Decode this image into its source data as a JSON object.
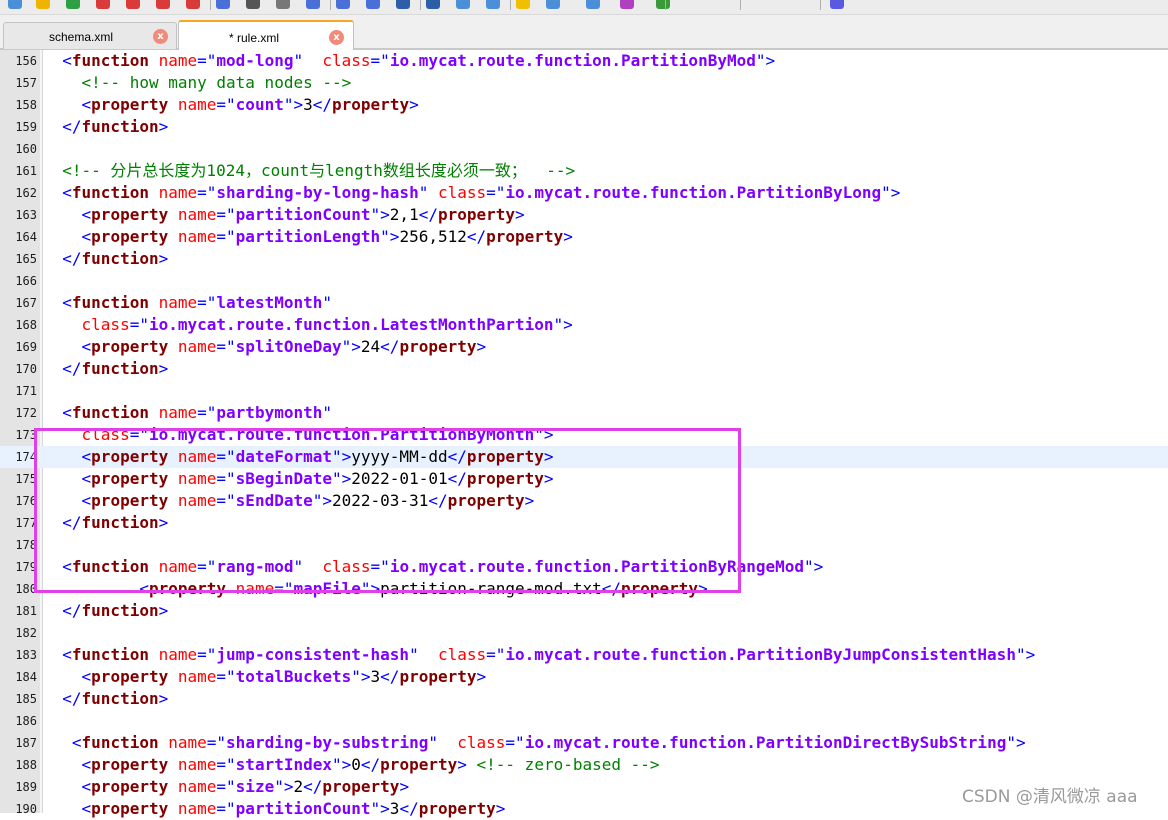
{
  "tabs": [
    {
      "label": "schema.xml",
      "active": false,
      "close": "x"
    },
    {
      "label": "* rule.xml",
      "active": true,
      "close": "x"
    }
  ],
  "editor_lines": [
    {
      "num": "156",
      "tokens": [
        [
          "ind",
          "  "
        ],
        [
          "p",
          "<"
        ],
        [
          "tag",
          "function"
        ],
        [
          "txt",
          " "
        ],
        [
          "attr",
          "name"
        ],
        [
          "p",
          "=\""
        ],
        [
          "val",
          "mod-long"
        ],
        [
          "p",
          "\""
        ],
        [
          "txt",
          "  "
        ],
        [
          "attr",
          "class"
        ],
        [
          "p",
          "=\""
        ],
        [
          "val",
          "io.mycat.route.function.PartitionByMod"
        ],
        [
          "p",
          "\">"
        ]
      ]
    },
    {
      "num": "157",
      "tokens": [
        [
          "ind",
          "    "
        ],
        [
          "com",
          "<!-- how many data nodes -->"
        ]
      ]
    },
    {
      "num": "158",
      "tokens": [
        [
          "ind",
          "    "
        ],
        [
          "p",
          "<"
        ],
        [
          "tag",
          "property"
        ],
        [
          "txt",
          " "
        ],
        [
          "attr",
          "name"
        ],
        [
          "p",
          "=\""
        ],
        [
          "val",
          "count"
        ],
        [
          "p",
          "\">"
        ],
        [
          "txt",
          "3"
        ],
        [
          "p",
          "</"
        ],
        [
          "tag",
          "property"
        ],
        [
          "p",
          ">"
        ]
      ]
    },
    {
      "num": "159",
      "tokens": [
        [
          "ind",
          "  "
        ],
        [
          "p",
          "</"
        ],
        [
          "tag",
          "function"
        ],
        [
          "p",
          ">"
        ]
      ]
    },
    {
      "num": "160",
      "tokens": []
    },
    {
      "num": "161",
      "tokens": [
        [
          "ind",
          "  "
        ],
        [
          "com",
          "<!-- 分片总长度为1024，count与length数组长度必须一致；  -->"
        ]
      ]
    },
    {
      "num": "162",
      "tokens": [
        [
          "ind",
          "  "
        ],
        [
          "p",
          "<"
        ],
        [
          "tag",
          "function"
        ],
        [
          "txt",
          " "
        ],
        [
          "attr",
          "name"
        ],
        [
          "p",
          "=\""
        ],
        [
          "val",
          "sharding-by-long-hash"
        ],
        [
          "p",
          "\""
        ],
        [
          "txt",
          " "
        ],
        [
          "attr",
          "class"
        ],
        [
          "p",
          "=\""
        ],
        [
          "val",
          "io.mycat.route.function.PartitionByLong"
        ],
        [
          "p",
          "\">"
        ]
      ]
    },
    {
      "num": "163",
      "tokens": [
        [
          "ind",
          "    "
        ],
        [
          "p",
          "<"
        ],
        [
          "tag",
          "property"
        ],
        [
          "txt",
          " "
        ],
        [
          "attr",
          "name"
        ],
        [
          "p",
          "=\""
        ],
        [
          "val",
          "partitionCount"
        ],
        [
          "p",
          "\">"
        ],
        [
          "txt",
          "2,1"
        ],
        [
          "p",
          "</"
        ],
        [
          "tag",
          "property"
        ],
        [
          "p",
          ">"
        ]
      ]
    },
    {
      "num": "164",
      "tokens": [
        [
          "ind",
          "    "
        ],
        [
          "p",
          "<"
        ],
        [
          "tag",
          "property"
        ],
        [
          "txt",
          " "
        ],
        [
          "attr",
          "name"
        ],
        [
          "p",
          "=\""
        ],
        [
          "val",
          "partitionLength"
        ],
        [
          "p",
          "\">"
        ],
        [
          "txt",
          "256,512"
        ],
        [
          "p",
          "</"
        ],
        [
          "tag",
          "property"
        ],
        [
          "p",
          ">"
        ]
      ]
    },
    {
      "num": "165",
      "tokens": [
        [
          "ind",
          "  "
        ],
        [
          "p",
          "</"
        ],
        [
          "tag",
          "function"
        ],
        [
          "p",
          ">"
        ]
      ]
    },
    {
      "num": "166",
      "tokens": []
    },
    {
      "num": "167",
      "tokens": [
        [
          "ind",
          "  "
        ],
        [
          "p",
          "<"
        ],
        [
          "tag",
          "function"
        ],
        [
          "txt",
          " "
        ],
        [
          "attr",
          "name"
        ],
        [
          "p",
          "=\""
        ],
        [
          "val",
          "latestMonth"
        ],
        [
          "p",
          "\""
        ]
      ]
    },
    {
      "num": "168",
      "tokens": [
        [
          "ind",
          "    "
        ],
        [
          "attr",
          "class"
        ],
        [
          "p",
          "=\""
        ],
        [
          "val",
          "io.mycat.route.function.LatestMonthPartion"
        ],
        [
          "p",
          "\">"
        ]
      ]
    },
    {
      "num": "169",
      "tokens": [
        [
          "ind",
          "    "
        ],
        [
          "p",
          "<"
        ],
        [
          "tag",
          "property"
        ],
        [
          "txt",
          " "
        ],
        [
          "attr",
          "name"
        ],
        [
          "p",
          "=\""
        ],
        [
          "val",
          "splitOneDay"
        ],
        [
          "p",
          "\">"
        ],
        [
          "txt",
          "24"
        ],
        [
          "p",
          "</"
        ],
        [
          "tag",
          "property"
        ],
        [
          "p",
          ">"
        ]
      ]
    },
    {
      "num": "170",
      "tokens": [
        [
          "ind",
          "  "
        ],
        [
          "p",
          "</"
        ],
        [
          "tag",
          "function"
        ],
        [
          "p",
          ">"
        ]
      ]
    },
    {
      "num": "171",
      "tokens": []
    },
    {
      "num": "172",
      "tokens": [
        [
          "ind",
          "  "
        ],
        [
          "p",
          "<"
        ],
        [
          "tag",
          "function"
        ],
        [
          "txt",
          " "
        ],
        [
          "attr",
          "name"
        ],
        [
          "p",
          "=\""
        ],
        [
          "val",
          "partbymonth"
        ],
        [
          "p",
          "\""
        ]
      ]
    },
    {
      "num": "173",
      "tokens": [
        [
          "ind",
          "    "
        ],
        [
          "attr",
          "class"
        ],
        [
          "p",
          "=\""
        ],
        [
          "val",
          "io.mycat.route.function.PartitionByMonth"
        ],
        [
          "p",
          "\">"
        ]
      ]
    },
    {
      "num": "174",
      "current": true,
      "tokens": [
        [
          "ind",
          "    "
        ],
        [
          "p",
          "<"
        ],
        [
          "tag",
          "property"
        ],
        [
          "txt",
          " "
        ],
        [
          "attr",
          "name"
        ],
        [
          "p",
          "=\""
        ],
        [
          "val",
          "dateFormat"
        ],
        [
          "p",
          "\">"
        ],
        [
          "txt",
          "yyyy-MM-dd"
        ],
        [
          "p",
          "</"
        ],
        [
          "tag",
          "property"
        ],
        [
          "p",
          ">"
        ]
      ]
    },
    {
      "num": "175",
      "tokens": [
        [
          "ind",
          "    "
        ],
        [
          "p",
          "<"
        ],
        [
          "tag",
          "property"
        ],
        [
          "txt",
          " "
        ],
        [
          "attr",
          "name"
        ],
        [
          "p",
          "=\""
        ],
        [
          "val",
          "sBeginDate"
        ],
        [
          "p",
          "\">"
        ],
        [
          "txt",
          "2022-01-01"
        ],
        [
          "p",
          "</"
        ],
        [
          "tag",
          "property"
        ],
        [
          "p",
          ">"
        ]
      ]
    },
    {
      "num": "176",
      "tokens": [
        [
          "ind",
          "    "
        ],
        [
          "p",
          "<"
        ],
        [
          "tag",
          "property"
        ],
        [
          "txt",
          " "
        ],
        [
          "attr",
          "name"
        ],
        [
          "p",
          "=\""
        ],
        [
          "val",
          "sEndDate"
        ],
        [
          "p",
          "\">"
        ],
        [
          "txt",
          "2022-03-31"
        ],
        [
          "p",
          "</"
        ],
        [
          "tag",
          "property"
        ],
        [
          "p",
          ">"
        ]
      ]
    },
    {
      "num": "177",
      "tokens": [
        [
          "ind",
          "  "
        ],
        [
          "p",
          "</"
        ],
        [
          "tag",
          "function"
        ],
        [
          "p",
          ">"
        ]
      ]
    },
    {
      "num": "178",
      "tokens": []
    },
    {
      "num": "179",
      "tokens": [
        [
          "ind",
          "  "
        ],
        [
          "p",
          "<"
        ],
        [
          "tag",
          "function"
        ],
        [
          "txt",
          " "
        ],
        [
          "attr",
          "name"
        ],
        [
          "p",
          "=\""
        ],
        [
          "val",
          "rang-mod"
        ],
        [
          "p",
          "\""
        ],
        [
          "txt",
          "  "
        ],
        [
          "attr",
          "class"
        ],
        [
          "p",
          "=\""
        ],
        [
          "val",
          "io.mycat.route.function.PartitionByRangeMod"
        ],
        [
          "p",
          "\">"
        ]
      ]
    },
    {
      "num": "180",
      "tokens": [
        [
          "ind",
          "          "
        ],
        [
          "p",
          "<"
        ],
        [
          "tag",
          "property"
        ],
        [
          "txt",
          " "
        ],
        [
          "attr",
          "name"
        ],
        [
          "p",
          "=\""
        ],
        [
          "val",
          "mapFile"
        ],
        [
          "p",
          "\">"
        ],
        [
          "txt",
          "partition-range-mod.txt"
        ],
        [
          "p",
          "</"
        ],
        [
          "tag",
          "property"
        ],
        [
          "p",
          ">"
        ]
      ]
    },
    {
      "num": "181",
      "tokens": [
        [
          "ind",
          "  "
        ],
        [
          "p",
          "</"
        ],
        [
          "tag",
          "function"
        ],
        [
          "p",
          ">"
        ]
      ]
    },
    {
      "num": "182",
      "tokens": []
    },
    {
      "num": "183",
      "tokens": [
        [
          "ind",
          "  "
        ],
        [
          "p",
          "<"
        ],
        [
          "tag",
          "function"
        ],
        [
          "txt",
          " "
        ],
        [
          "attr",
          "name"
        ],
        [
          "p",
          "=\""
        ],
        [
          "val",
          "jump-consistent-hash"
        ],
        [
          "p",
          "\""
        ],
        [
          "txt",
          "  "
        ],
        [
          "attr",
          "class"
        ],
        [
          "p",
          "=\""
        ],
        [
          "val",
          "io.mycat.route.function.PartitionByJumpConsistentHash"
        ],
        [
          "p",
          "\">"
        ]
      ]
    },
    {
      "num": "184",
      "tokens": [
        [
          "ind",
          "    "
        ],
        [
          "p",
          "<"
        ],
        [
          "tag",
          "property"
        ],
        [
          "txt",
          " "
        ],
        [
          "attr",
          "name"
        ],
        [
          "p",
          "=\""
        ],
        [
          "val",
          "totalBuckets"
        ],
        [
          "p",
          "\">"
        ],
        [
          "txt",
          "3"
        ],
        [
          "p",
          "</"
        ],
        [
          "tag",
          "property"
        ],
        [
          "p",
          ">"
        ]
      ]
    },
    {
      "num": "185",
      "tokens": [
        [
          "ind",
          "  "
        ],
        [
          "p",
          "</"
        ],
        [
          "tag",
          "function"
        ],
        [
          "p",
          ">"
        ]
      ]
    },
    {
      "num": "186",
      "tokens": []
    },
    {
      "num": "187",
      "tokens": [
        [
          "ind",
          "   "
        ],
        [
          "p",
          "<"
        ],
        [
          "tag",
          "function"
        ],
        [
          "txt",
          " "
        ],
        [
          "attr",
          "name"
        ],
        [
          "p",
          "=\""
        ],
        [
          "val",
          "sharding-by-substring"
        ],
        [
          "p",
          "\""
        ],
        [
          "txt",
          "  "
        ],
        [
          "attr",
          "class"
        ],
        [
          "p",
          "=\""
        ],
        [
          "val",
          "io.mycat.route.function.PartitionDirectBySubString"
        ],
        [
          "p",
          "\">"
        ]
      ]
    },
    {
      "num": "188",
      "tokens": [
        [
          "ind",
          "    "
        ],
        [
          "p",
          "<"
        ],
        [
          "tag",
          "property"
        ],
        [
          "txt",
          " "
        ],
        [
          "attr",
          "name"
        ],
        [
          "p",
          "=\""
        ],
        [
          "val",
          "startIndex"
        ],
        [
          "p",
          "\">"
        ],
        [
          "txt",
          "0"
        ],
        [
          "p",
          "</"
        ],
        [
          "tag",
          "property"
        ],
        [
          "p",
          ">"
        ],
        [
          "txt",
          " "
        ],
        [
          "com",
          "<!-- zero-based -->"
        ]
      ]
    },
    {
      "num": "189",
      "tokens": [
        [
          "ind",
          "    "
        ],
        [
          "p",
          "<"
        ],
        [
          "tag",
          "property"
        ],
        [
          "txt",
          " "
        ],
        [
          "attr",
          "name"
        ],
        [
          "p",
          "=\""
        ],
        [
          "val",
          "size"
        ],
        [
          "p",
          "\">"
        ],
        [
          "txt",
          "2"
        ],
        [
          "p",
          "</"
        ],
        [
          "tag",
          "property"
        ],
        [
          "p",
          ">"
        ]
      ]
    },
    {
      "num": "190",
      "tokens": [
        [
          "ind",
          "    "
        ],
        [
          "p",
          "<"
        ],
        [
          "tag",
          "property"
        ],
        [
          "txt",
          " "
        ],
        [
          "attr",
          "name"
        ],
        [
          "p",
          "=\""
        ],
        [
          "val",
          "partitionCount"
        ],
        [
          "p",
          "\">"
        ],
        [
          "txt",
          "3"
        ],
        [
          "p",
          "</"
        ],
        [
          "tag",
          "property"
        ],
        [
          "p",
          ">"
        ]
      ]
    }
  ],
  "watermark": "CSDN @清风微凉 aaa",
  "colors": {
    "tag": "#800000",
    "punctuation": "#0000ff",
    "attribute": "#ff0000",
    "value": "#8000ff",
    "comment": "#008000",
    "current_line": "#e8f2fe",
    "highlight_box": "#e040e8",
    "active_tab_accent": "#f5a623"
  },
  "toolbar_icons": [
    "new-icon",
    "open-icon",
    "refresh-icon",
    "save-icon",
    "save-all-icon",
    "close-icon",
    "close-all-icon",
    "print-icon",
    "cut-icon",
    "copy-icon",
    "paste-icon",
    "undo-icon",
    "redo-icon",
    "find-icon",
    "replace-icon",
    "zoom-in-icon",
    "zoom-out-icon",
    "sync-icon",
    "wrap-icon",
    "indent-icon",
    "macro-icon",
    "run-icon",
    "plugin-icon"
  ]
}
